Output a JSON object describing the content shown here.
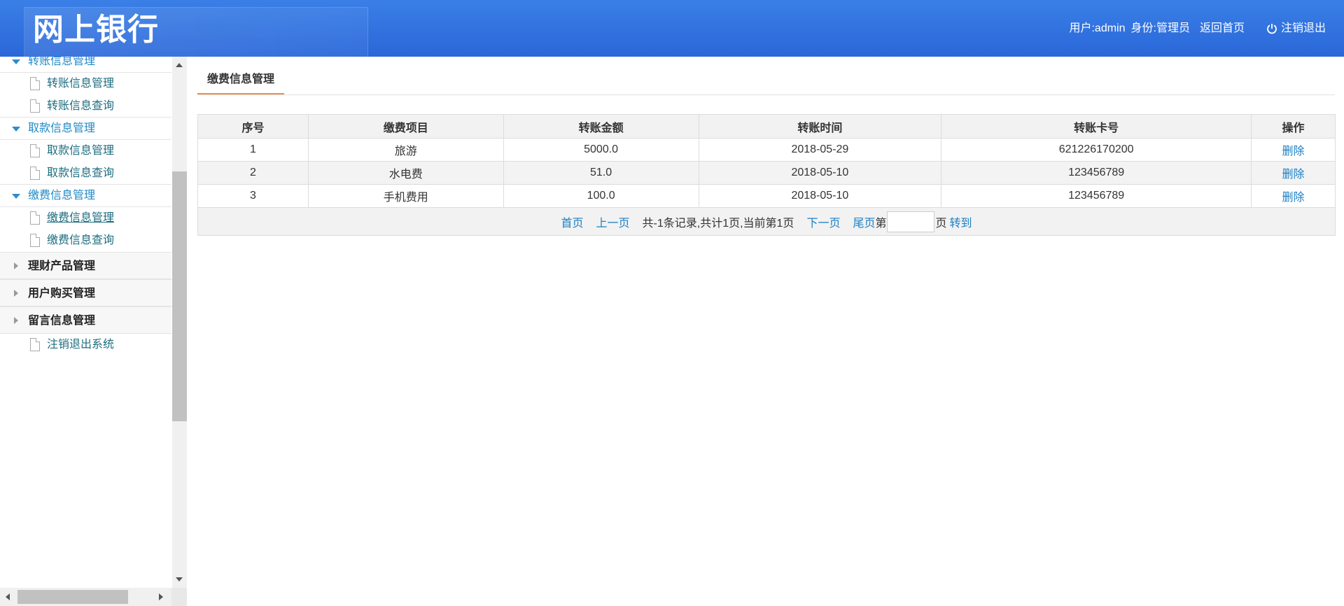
{
  "header": {
    "logo": "网上银行",
    "user_label": "用户:",
    "user_value": "admin",
    "role_label": "身份:",
    "role_value": "管理员",
    "home_link": "返回首页",
    "logout_link": "注销退出"
  },
  "sidebar": {
    "groups": [
      {
        "label": "转账信息管理",
        "open": true,
        "items": [
          {
            "label": "转账信息管理"
          },
          {
            "label": "转账信息查询"
          }
        ]
      },
      {
        "label": "取款信息管理",
        "open": true,
        "items": [
          {
            "label": "取款信息管理"
          },
          {
            "label": "取款信息查询"
          }
        ]
      },
      {
        "label": "缴费信息管理",
        "open": true,
        "items": [
          {
            "label": "缴费信息管理",
            "active": true
          },
          {
            "label": "缴费信息查询"
          }
        ]
      },
      {
        "label": "理财产品管理",
        "open": false
      },
      {
        "label": "用户购买管理",
        "open": false
      },
      {
        "label": "留言信息管理",
        "open": false,
        "items": [
          {
            "label": "注销退出系统"
          }
        ]
      }
    ]
  },
  "main": {
    "tab": "缴费信息管理",
    "columns": [
      "序号",
      "缴费项目",
      "转账金额",
      "转账时间",
      "转账卡号",
      "操作"
    ],
    "rows": [
      {
        "no": "1",
        "item": "旅游",
        "amount": "5000.0",
        "time": "2018-05-29",
        "card": "621226170200",
        "action": "删除"
      },
      {
        "no": "2",
        "item": "水电费",
        "amount": "51.0",
        "time": "2018-05-10",
        "card": "123456789",
        "action": "删除"
      },
      {
        "no": "3",
        "item": "手机费用",
        "amount": "100.0",
        "time": "2018-05-10",
        "card": "123456789",
        "action": "删除"
      }
    ],
    "pager": {
      "first": "首页",
      "prev": "上一页",
      "info": "共-1条记录,共计1页,当前第1页",
      "next": "下一页",
      "last": "尾页",
      "page_prefix": "第",
      "page_input": "",
      "page_suffix": "页",
      "go": "转到"
    }
  },
  "colors": {
    "header_bg": "#2a67d9",
    "link": "#1b7fc4",
    "sidebar_open": "#1f8ac7",
    "sub_item": "#1d6d7f",
    "tab_underline": "#f28d4a"
  },
  "icons": {
    "group_open": "triangle-down-icon",
    "group_closed": "triangle-right-icon",
    "sub_item": "document-icon",
    "logout": "power-icon"
  }
}
